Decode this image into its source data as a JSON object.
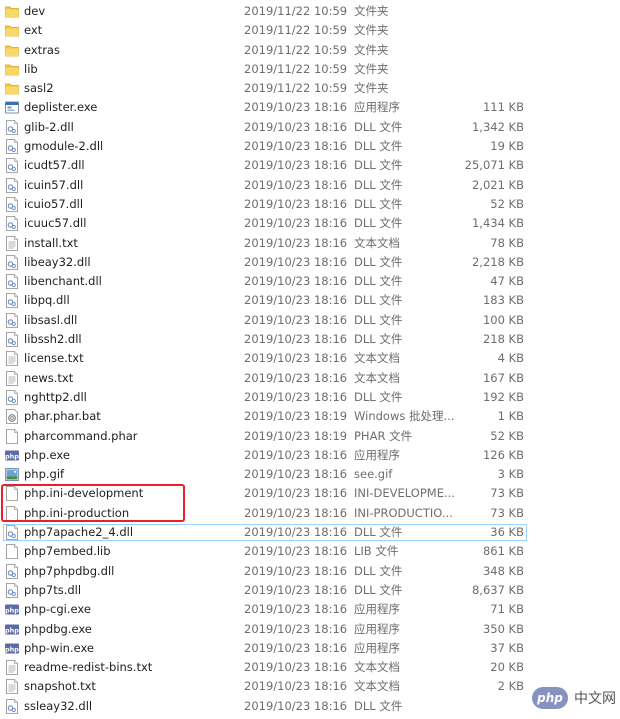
{
  "files": [
    {
      "name": "dev",
      "date": "2019/11/22 10:59",
      "type": "文件夹",
      "size": "",
      "icon": "folder-icon"
    },
    {
      "name": "ext",
      "date": "2019/11/22 10:59",
      "type": "文件夹",
      "size": "",
      "icon": "folder-icon"
    },
    {
      "name": "extras",
      "date": "2019/11/22 10:59",
      "type": "文件夹",
      "size": "",
      "icon": "folder-icon"
    },
    {
      "name": "lib",
      "date": "2019/11/22 10:59",
      "type": "文件夹",
      "size": "",
      "icon": "folder-icon"
    },
    {
      "name": "sasl2",
      "date": "2019/11/22 10:59",
      "type": "文件夹",
      "size": "",
      "icon": "folder-icon"
    },
    {
      "name": "deplister.exe",
      "date": "2019/10/23 18:16",
      "type": "应用程序",
      "size": "111 KB",
      "icon": "exe-icon"
    },
    {
      "name": "glib-2.dll",
      "date": "2019/10/23 18:16",
      "type": "DLL 文件",
      "size": "1,342 KB",
      "icon": "dll-icon"
    },
    {
      "name": "gmodule-2.dll",
      "date": "2019/10/23 18:16",
      "type": "DLL 文件",
      "size": "19 KB",
      "icon": "dll-icon"
    },
    {
      "name": "icudt57.dll",
      "date": "2019/10/23 18:16",
      "type": "DLL 文件",
      "size": "25,071 KB",
      "icon": "dll-icon"
    },
    {
      "name": "icuin57.dll",
      "date": "2019/10/23 18:16",
      "type": "DLL 文件",
      "size": "2,021 KB",
      "icon": "dll-icon"
    },
    {
      "name": "icuio57.dll",
      "date": "2019/10/23 18:16",
      "type": "DLL 文件",
      "size": "52 KB",
      "icon": "dll-icon"
    },
    {
      "name": "icuuc57.dll",
      "date": "2019/10/23 18:16",
      "type": "DLL 文件",
      "size": "1,434 KB",
      "icon": "dll-icon"
    },
    {
      "name": "install.txt",
      "date": "2019/10/23 18:16",
      "type": "文本文档",
      "size": "78 KB",
      "icon": "text-file-icon"
    },
    {
      "name": "libeay32.dll",
      "date": "2019/10/23 18:16",
      "type": "DLL 文件",
      "size": "2,218 KB",
      "icon": "dll-icon"
    },
    {
      "name": "libenchant.dll",
      "date": "2019/10/23 18:16",
      "type": "DLL 文件",
      "size": "47 KB",
      "icon": "dll-icon"
    },
    {
      "name": "libpq.dll",
      "date": "2019/10/23 18:16",
      "type": "DLL 文件",
      "size": "183 KB",
      "icon": "dll-icon"
    },
    {
      "name": "libsasl.dll",
      "date": "2019/10/23 18:16",
      "type": "DLL 文件",
      "size": "100 KB",
      "icon": "dll-icon"
    },
    {
      "name": "libssh2.dll",
      "date": "2019/10/23 18:16",
      "type": "DLL 文件",
      "size": "218 KB",
      "icon": "dll-icon"
    },
    {
      "name": "license.txt",
      "date": "2019/10/23 18:16",
      "type": "文本文档",
      "size": "4 KB",
      "icon": "text-file-icon"
    },
    {
      "name": "news.txt",
      "date": "2019/10/23 18:16",
      "type": "文本文档",
      "size": "167 KB",
      "icon": "text-file-icon"
    },
    {
      "name": "nghttp2.dll",
      "date": "2019/10/23 18:16",
      "type": "DLL 文件",
      "size": "192 KB",
      "icon": "dll-icon"
    },
    {
      "name": "phar.phar.bat",
      "date": "2019/10/23 18:19",
      "type": "Windows 批处理...",
      "size": "1 KB",
      "icon": "batch-file-icon"
    },
    {
      "name": "pharcommand.phar",
      "date": "2019/10/23 18:19",
      "type": "PHAR 文件",
      "size": "52 KB",
      "icon": "blank-file-icon"
    },
    {
      "name": "php.exe",
      "date": "2019/10/23 18:16",
      "type": "应用程序",
      "size": "126 KB",
      "icon": "php-exe-icon"
    },
    {
      "name": "php.gif",
      "date": "2019/10/23 18:16",
      "type": "see.gif",
      "size": "3 KB",
      "icon": "image-file-icon"
    },
    {
      "name": "php.ini-development",
      "date": "2019/10/23 18:16",
      "type": "INI-DEVELOPME...",
      "size": "73 KB",
      "icon": "blank-file-icon"
    },
    {
      "name": "php.ini-production",
      "date": "2019/10/23 18:16",
      "type": "INI-PRODUCTIO...",
      "size": "73 KB",
      "icon": "blank-file-icon"
    },
    {
      "name": "php7apache2_4.dll",
      "date": "2019/10/23 18:16",
      "type": "DLL 文件",
      "size": "36 KB",
      "icon": "dll-icon",
      "selected": true
    },
    {
      "name": "php7embed.lib",
      "date": "2019/10/23 18:16",
      "type": "LIB 文件",
      "size": "861 KB",
      "icon": "blank-file-icon"
    },
    {
      "name": "php7phpdbg.dll",
      "date": "2019/10/23 18:16",
      "type": "DLL 文件",
      "size": "348 KB",
      "icon": "dll-icon"
    },
    {
      "name": "php7ts.dll",
      "date": "2019/10/23 18:16",
      "type": "DLL 文件",
      "size": "8,637 KB",
      "icon": "dll-icon"
    },
    {
      "name": "php-cgi.exe",
      "date": "2019/10/23 18:16",
      "type": "应用程序",
      "size": "71 KB",
      "icon": "php-exe-icon"
    },
    {
      "name": "phpdbg.exe",
      "date": "2019/10/23 18:16",
      "type": "应用程序",
      "size": "350 KB",
      "icon": "php-exe-icon"
    },
    {
      "name": "php-win.exe",
      "date": "2019/10/23 18:16",
      "type": "应用程序",
      "size": "37 KB",
      "icon": "php-exe-icon"
    },
    {
      "name": "readme-redist-bins.txt",
      "date": "2019/10/23 18:16",
      "type": "文本文档",
      "size": "20 KB",
      "icon": "text-file-icon"
    },
    {
      "name": "snapshot.txt",
      "date": "2019/10/23 18:16",
      "type": "文本文档",
      "size": "2 KB",
      "icon": "text-file-icon"
    },
    {
      "name": "ssleay32.dll",
      "date": "2019/10/23 18:16",
      "type": "DLL 文件",
      "size": "",
      "icon": "dll-icon"
    }
  ],
  "watermark": {
    "badge": "php",
    "text": "中文网"
  },
  "colors": {
    "folder": "#f3c842",
    "selection_border": "#99d1ff",
    "annotation_red": "#e8202a",
    "php_purple": "#8892bf",
    "meta_text": "#6d6d6d"
  }
}
